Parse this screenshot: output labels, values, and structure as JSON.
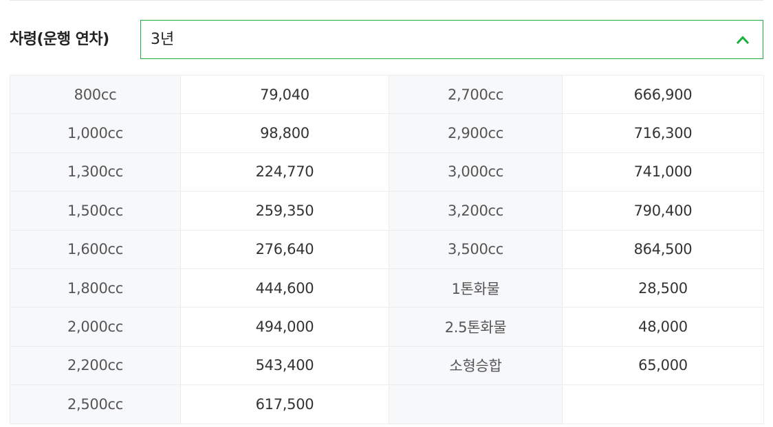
{
  "selector": {
    "label": "차령(운행 연차)",
    "value": "3년",
    "accent_color": "#19ae3c",
    "icon": "chevron-up-icon"
  },
  "rates": [
    [
      "800cc",
      "79,040",
      "2,700cc",
      "666,900"
    ],
    [
      "1,000cc",
      "98,800",
      "2,900cc",
      "716,300"
    ],
    [
      "1,300cc",
      "224,770",
      "3,000cc",
      "741,000"
    ],
    [
      "1,500cc",
      "259,350",
      "3,200cc",
      "790,400"
    ],
    [
      "1,600cc",
      "276,640",
      "3,500cc",
      "864,500"
    ],
    [
      "1,800cc",
      "444,600",
      "1톤화물",
      "28,500"
    ],
    [
      "2,000cc",
      "494,000",
      "2.5톤화물",
      "48,000"
    ],
    [
      "2,200cc",
      "543,400",
      "소형승합",
      "65,000"
    ],
    [
      "2,500cc",
      "617,500",
      "",
      ""
    ]
  ]
}
